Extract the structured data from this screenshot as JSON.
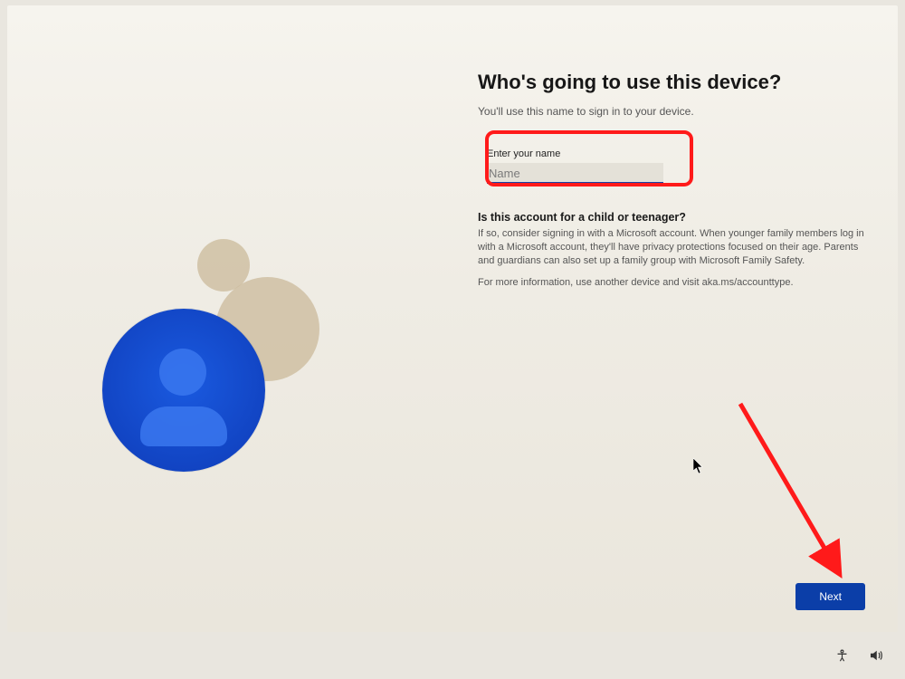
{
  "heading": "Who's going to use this device?",
  "subtitle": "You'll use this name to sign in to your device.",
  "name_field": {
    "label": "Enter your name",
    "placeholder": "Name",
    "value": ""
  },
  "child_section": {
    "heading": "Is this account for a child or teenager?",
    "body": "If so, consider signing in with a Microsoft account. When younger family members log in with a Microsoft account, they'll have privacy protections focused on their age. Parents and guardians can also set up a family group with Microsoft Family Safety.",
    "more": "For more information, use another device and visit aka.ms/accounttype."
  },
  "buttons": {
    "next": "Next"
  },
  "system_icons": {
    "accessibility": "accessibility-icon",
    "volume": "volume-icon"
  },
  "colors": {
    "accent": "#0b3ea8",
    "annotation": "#ff1a1a"
  }
}
